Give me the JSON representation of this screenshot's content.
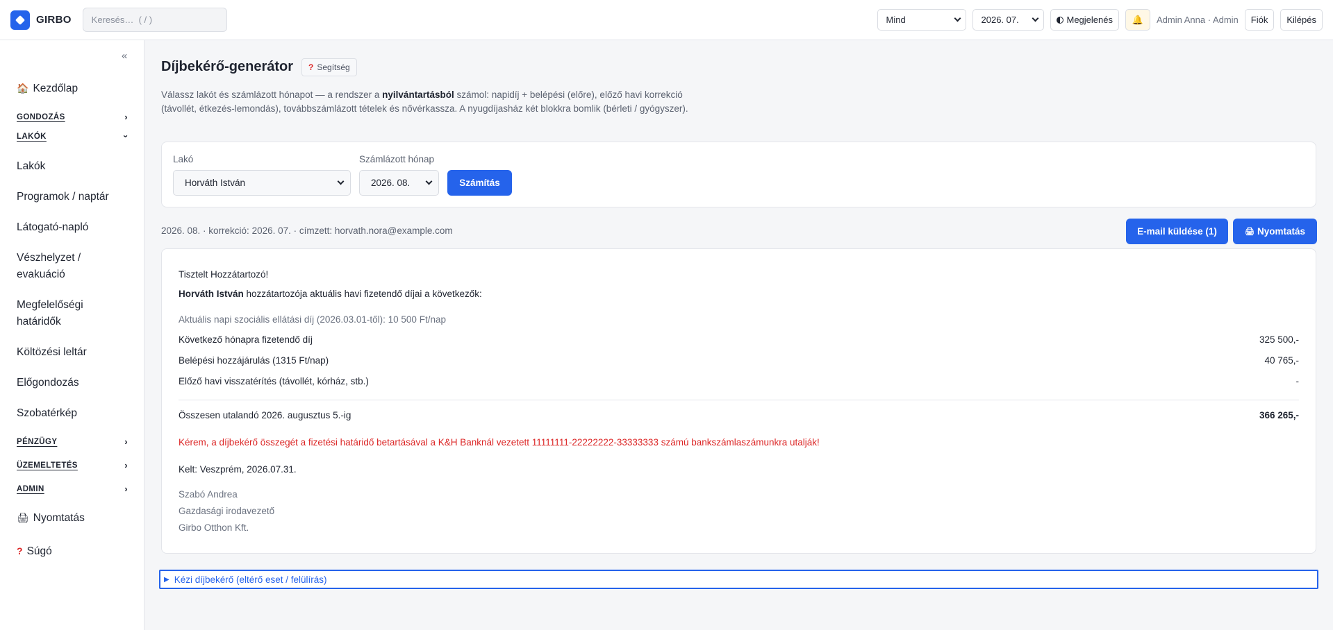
{
  "header": {
    "brand": "GIRBO",
    "search_placeholder": "Keresés…  ( / )",
    "filter_selected": "Mind",
    "month_selected": "2026. 07.",
    "appearance_label": "Megjelenés",
    "user": "Admin Anna · Admin",
    "account_label": "Fiók",
    "logout_label": "Kilépés"
  },
  "sidebar": {
    "home": "Kezdőlap",
    "sections": {
      "gondozas": "GONDOZÁS",
      "lakok": "LAKÓK",
      "penzugy": "PÉNZÜGY",
      "uzemeltetes": "ÜZEMELTETÉS",
      "admin": "ADMIN"
    },
    "items": [
      "Lakók",
      "Programok / naptár",
      "Látogató-napló",
      "Vészhelyzet /",
      "evakuáció",
      "Megfelelőségi",
      "határidők",
      "Költözési leltár",
      "Előgondozás",
      "Szobatérkép"
    ],
    "print": "Nyomtatás",
    "help": "Súgó"
  },
  "page": {
    "title": "Díjbekérő-generátor",
    "help_chip": "Segítség",
    "intro_pre": "Válassz lakót és számlázott hónapot — a rendszer a ",
    "intro_bold": "nyilvántartásból",
    "intro_post": " számol: napidíj + belépési (előre), előző havi korrekció (távollét, étkezés-lemondás), továbbszámlázott tételek és nővérkassza. A nyugdíjasház két blokkra bomlik (bérleti / gyógyszer).",
    "form": {
      "resident_label": "Lakó",
      "resident_value": "Horváth István",
      "month_label": "Számlázott hónap",
      "month_value": "2026. 08.",
      "calc_button": "Számítás"
    },
    "meta": "2026. 08. · korrekció: 2026. 07. · címzett: horvath.nora@example.com",
    "email_button": "E-mail küldése (1)",
    "print_button": "Nyomtatás"
  },
  "letter": {
    "greeting": "Tisztelt Hozzátartozó!",
    "resident_name": "Horváth István",
    "intro_rest": " hozzátartozója aktuális havi fizetendő díjai a következők:",
    "daily_rate": "Aktuális napi szociális ellátási díj (2026.03.01-től): 10 500 Ft/nap",
    "rows": [
      {
        "label": "Következő hónapra fizetendő díj",
        "amount": "325 500,-"
      },
      {
        "label": "Belépési hozzájárulás (1315 Ft/nap)",
        "amount": "40 765,-"
      },
      {
        "label": "Előző havi visszatérítés (távollét, kórház, stb.)",
        "amount": "-"
      }
    ],
    "total_label": "Összesen utalandó 2026. augusztus 5.-ig",
    "total_amount": "366 265,-",
    "bank_note": "Kérem, a díjbekérő összegét a fizetési határidő betartásával a K&H Banknál vezetett 11111111-22222222-33333333 számú bankszámlaszámunkra utalják!",
    "dated": "Kelt: Veszprém, 2026.07.31.",
    "signer_name": "Szabó Andrea",
    "signer_title": "Gazdasági irodavezető",
    "signer_org": "Girbo Otthon Kft."
  },
  "manual": {
    "label": "Kézi díjbekérő (eltérő eset / felülírás)"
  },
  "colors": {
    "accent": "#2563eb",
    "warning_text": "#dc2626"
  },
  "icons": {
    "home": "house-icon",
    "print": "printer-icon",
    "help": "question-icon",
    "bell": "bell-icon",
    "appearance": "contrast-icon"
  }
}
